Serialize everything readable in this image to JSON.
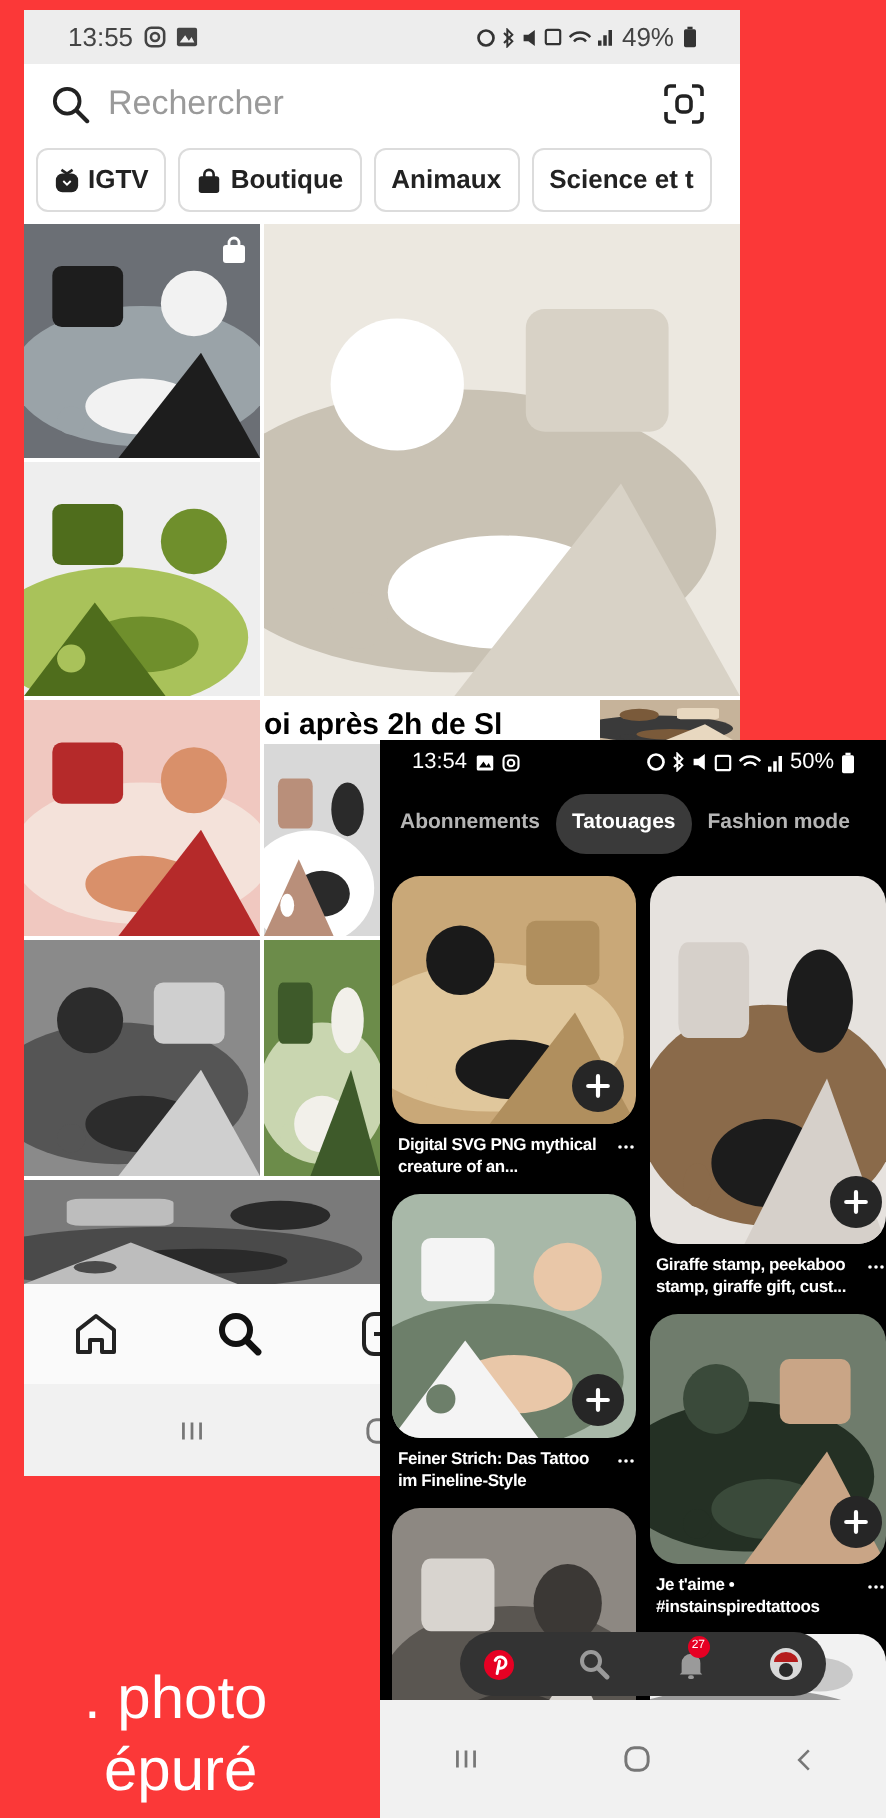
{
  "instagram": {
    "status_bar": {
      "time": "13:55",
      "battery": "49%"
    },
    "search": {
      "placeholder": "Rechercher"
    },
    "chips": [
      {
        "label": "IGTV",
        "kind": "tv"
      },
      {
        "label": "Boutique",
        "kind": "shop"
      },
      {
        "label": "Animaux",
        "kind": "text"
      },
      {
        "label": "Science et t",
        "kind": "text"
      }
    ],
    "post_caption": "oi après 2h de Sl"
  },
  "pinterest": {
    "status_bar": {
      "time": "13:54",
      "battery": "50%"
    },
    "tabs": [
      {
        "label": "Abonnements",
        "selected": false
      },
      {
        "label": "Tatouages",
        "selected": true
      },
      {
        "label": "Fashion mode",
        "selected": false
      }
    ],
    "columns": [
      [
        {
          "title": "Digital SVG PNG mythical creature of an..."
        },
        {
          "title": "Feiner Strich: Das Tattoo im Fineline-Style"
        },
        {}
      ],
      [
        {
          "title": "Giraffe stamp, peekaboo stamp, giraffe gift, cust..."
        },
        {
          "title": "Je t'aime • #instainspiredtattoos"
        },
        {}
      ]
    ],
    "notifications": "27"
  },
  "caption": [
    ". photo",
    "épuré"
  ]
}
